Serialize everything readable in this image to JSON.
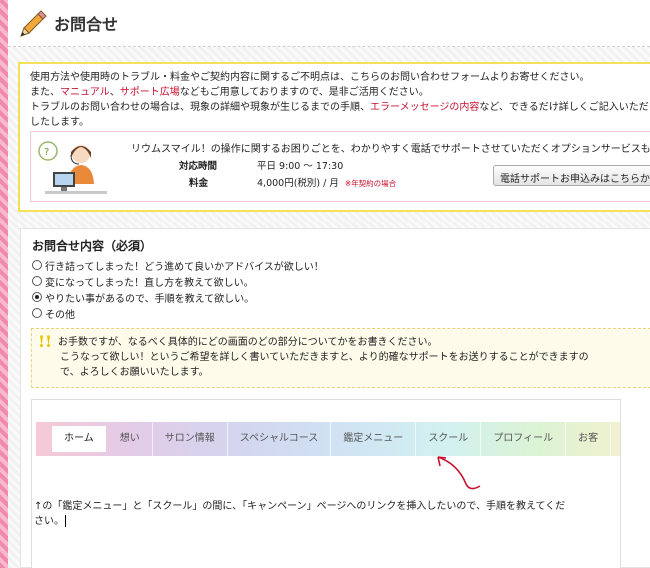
{
  "page": {
    "title": "お問合せ"
  },
  "info": {
    "line1": "使用方法や使用時のトラブル・料金やご契約内容に関するご不明点は、こちらのお問い合わせフォームよりお寄せください。",
    "line2_pre": "また、",
    "manual_link": "マニュアル",
    "line2_sep": "、",
    "support_link": "サポート広場",
    "line2_post": "などもご用意しておりますので、是非ご活用ください。",
    "line3_pre": "トラブルのお問い合わせの場合は、現象の詳細や現象が生じるまでの手順、",
    "error_link": "エラーメッセージの内容",
    "line3_post": "など、できるだけ詳しくご記入いただけま",
    "line4": "したします。"
  },
  "support": {
    "title": "リウムスマイル！の操作に関するお困りごとを、わかりやすく電話でサポートさせていただくオプションサービスもご",
    "hours_label": "対応時間",
    "hours_value": "平日 9:00 ～ 17:30",
    "fee_label": "料金",
    "fee_value": "4,000円(税別) / 月",
    "fee_note": "※年契約の場合",
    "apply_button": "電話サポートお申込みはこちらから"
  },
  "form": {
    "section_title": "お問合せ内容（必須）",
    "options": [
      {
        "label": "行き詰ってしまった！どう進めて良いかアドバイスが欲しい！",
        "checked": false
      },
      {
        "label": "変になってしまった！直し方を教えて欲しい。",
        "checked": false
      },
      {
        "label": "やりたい事があるので、手順を教えて欲しい。",
        "checked": true
      },
      {
        "label": "その他",
        "checked": false
      }
    ],
    "hint_line1": "お手数ですが、なるべく具体的にどの画面のどの部分についてかをお書きください。",
    "hint_line2": "こうなって欲しい！というご希望を詳しく書いていただきますと、より的確なサポートをお送りすることができますの",
    "hint_line3": "で、よろしくお願いいたします。"
  },
  "editor": {
    "nav": [
      "ホーム",
      "想い",
      "サロン情報",
      "スペシャルコース",
      "鑑定メニュー",
      "スクール",
      "プロフィール",
      "お客"
    ],
    "text_line1": "↑の「鑑定メニュー」と「スクール」の間に、「キャンペーン」ページへのリンクを挿入したいので、手順を教えてくだ",
    "text_line2": "さい。"
  },
  "colors": {
    "accent_red": "#c8102e",
    "border_pink": "#ef8aa8",
    "info_border": "#f4e15a"
  }
}
